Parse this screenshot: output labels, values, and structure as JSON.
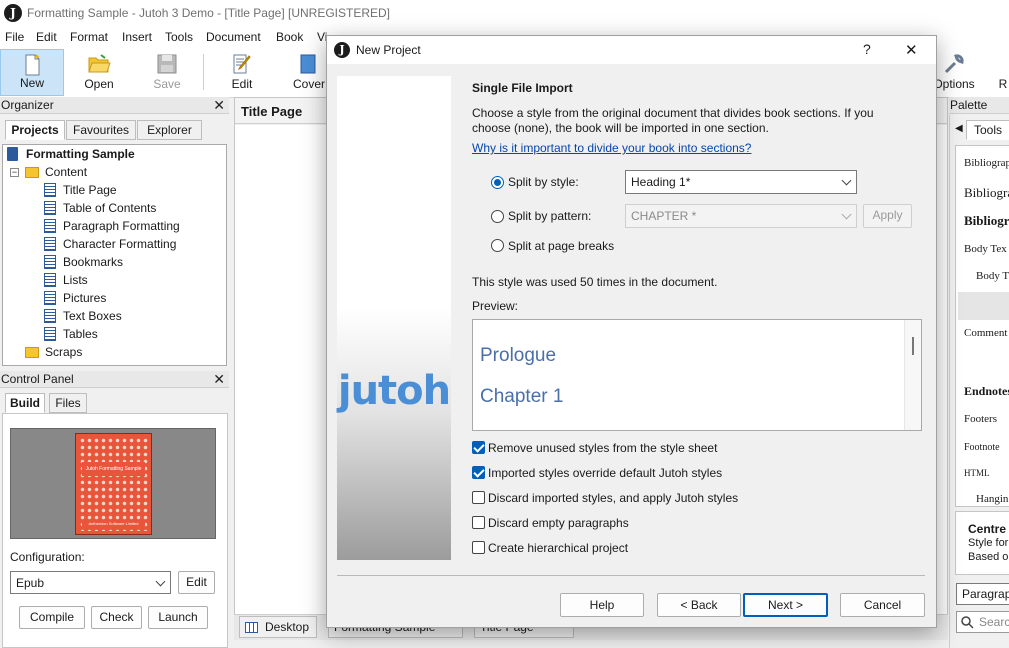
{
  "app": {
    "title": "Formatting Sample - Jutoh 3 Demo - [Title Page] [UNREGISTERED]",
    "icon_letter": "J"
  },
  "menu": [
    "File",
    "Edit",
    "Format",
    "Insert",
    "Tools",
    "Document",
    "Book",
    "Vi"
  ],
  "toolbar": {
    "new": "New",
    "open": "Open",
    "save": "Save",
    "edit": "Edit",
    "cover": "Cover",
    "options": "Options",
    "r": "R"
  },
  "organizer": {
    "title": "Organizer",
    "tabs": [
      "Projects",
      "Favourites",
      "Explorer"
    ],
    "project": "Formatting Sample",
    "content_folder": "Content",
    "items": [
      "Title Page",
      "Table of Contents",
      "Paragraph Formatting",
      "Character Formatting",
      "Bookmarks",
      "Lists",
      "Pictures",
      "Text Boxes",
      "Tables"
    ],
    "scraps": "Scraps"
  },
  "editor": {
    "doc_title": "Title Page",
    "bottom_tabs": [
      "Desktop",
      "Formatting Sample",
      "Title Page"
    ]
  },
  "control_panel": {
    "title": "Control Panel",
    "tabs": [
      "Build",
      "Files"
    ],
    "cover_text_top": "Jutoh Formatting Sample",
    "cover_text_bottom": "Anthemion Software Limited",
    "configuration_label": "Configuration:",
    "configuration_value": "Epub",
    "edit_button": "Edit",
    "compile_button": "Compile",
    "check_button": "Check",
    "launch_button": "Launch"
  },
  "palette": {
    "title": "Palette",
    "tools_tab": "Tools",
    "items": [
      "Bibliograp",
      "Bibliogra",
      "Bibliogr",
      "Body Tex",
      "Body T",
      "Comment",
      "Endnotes",
      "Footers",
      "Footnote",
      "HTML",
      "Hangin"
    ],
    "style_name": "Centre",
    "style_desc1": "Style for",
    "style_desc2": "Based o",
    "paragraph_dropdown": "Paragrap",
    "search_placeholder": "Searc"
  },
  "dialog": {
    "title": "New Project",
    "help_glyph": "?",
    "close_glyph": "✕",
    "logo": "jutoh",
    "heading": "Single File Import",
    "description": "Choose a style from the original document that divides book sections. If you choose (none), the book will be imported in one section.",
    "link": "Why is it important to divide your book into sections?",
    "split_by_style": "Split by style:",
    "split_by_style_value": "Heading 1*",
    "split_by_pattern": "Split by pattern:",
    "split_by_pattern_value": "CHAPTER *",
    "apply_button": "Apply",
    "split_at_page_breaks": "Split at page breaks",
    "usage_note": "This style was used 50 times in the document.",
    "preview_label": "Preview:",
    "preview_items": [
      "Prologue",
      "Chapter 1"
    ],
    "options": [
      {
        "label": "Remove unused styles from the style sheet",
        "checked": true
      },
      {
        "label": "Imported styles override default Jutoh styles",
        "checked": true
      },
      {
        "label": "Discard imported styles, and apply Jutoh styles",
        "checked": false
      },
      {
        "label": "Discard empty paragraphs",
        "checked": false
      },
      {
        "label": "Create hierarchical project",
        "checked": false
      }
    ],
    "help_button": "Help",
    "back_button": "< Back",
    "next_button": "Next >",
    "cancel_button": "Cancel"
  },
  "colors": {
    "accent": "#005fb8",
    "link": "#0645ad",
    "logo": "#4a8ed6",
    "cover": "#e8553a"
  }
}
